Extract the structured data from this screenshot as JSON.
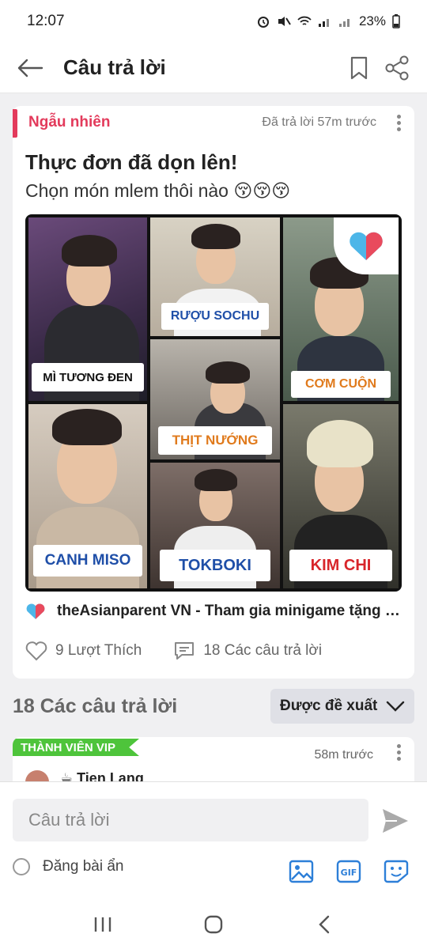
{
  "status": {
    "time": "12:07",
    "battery": "23%"
  },
  "header": {
    "title": "Câu trả lời"
  },
  "question": {
    "category": "Ngẫu nhiên",
    "answered_ago": "Đã trả lời 57m trước",
    "title": "Thực đơn đã dọn lên!",
    "subtitle": "Chọn món mlem thôi nào 😚😚😚",
    "collage_labels": {
      "t1": "MÌ TƯƠNG ĐEN",
      "t2": "RƯỢU SOCHU",
      "t3": "CƠM CUỘN",
      "t4": "THỊT NƯỚNG",
      "t5": "CANH MISO",
      "t6": "TOKBOKI",
      "t7": "KIM CHI"
    },
    "source": "theAsianparent VN - Tham gia minigame tặng quà",
    "likes": "9 Lượt Thích",
    "answers": "18 Các câu trả lời"
  },
  "answers_section": {
    "count_label": "18 Các câu trả lời",
    "sort_label": "Được đề xuất"
  },
  "answer": {
    "badge": "THÀNH VIÊN VIP",
    "time": "58m trước",
    "username": "☕ Tien Lang"
  },
  "composer": {
    "placeholder": "Câu trả lời",
    "anonymous_label": "Đăng bài ẩn"
  },
  "colors": {
    "accent": "#e33a5b",
    "vip_green": "#4ec43b",
    "tool_blue": "#2d7fd8",
    "label_blue": "#1f4fa8",
    "label_red": "#d8262b",
    "label_orange": "#e07a1c"
  }
}
